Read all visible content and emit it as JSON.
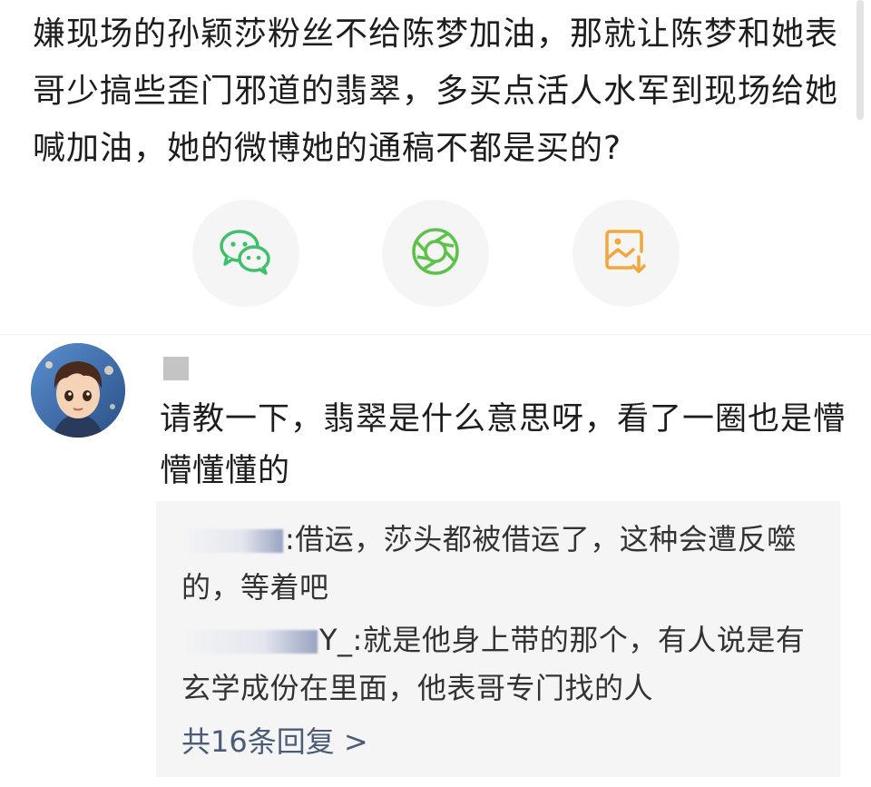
{
  "post": {
    "text": "嫌现场的孙颖莎粉丝不给陈梦加油，那就让陈梦和她表哥少搞些歪门邪道的翡翠，多买点活人水军到现场给她喊加油，她的微博她的通稿不都是买的?"
  },
  "share": {
    "wechat_icon": "wechat-icon",
    "moments_icon": "moments-icon",
    "save_icon": "save-image-icon",
    "colors": {
      "wechat": "#3fc06a",
      "moments": "#5cc24a",
      "save": "#f0a83a",
      "button_bg": "#f5f5f5"
    }
  },
  "comment": {
    "avatar_icon": "avatar-boy",
    "text": "请教一下，翡翠是什么意思呀，看了一圈也是懵懵懂懂的",
    "replies": [
      {
        "user_suffix": "【",
        "user_tail": "\u0011",
        "user_visible": ":",
        "text": "借运，莎头都被借运了，这种会遭反噬的，等着吧"
      },
      {
        "user_visible": "Y_:",
        "text": "就是他身上带的那个，有人说是有玄学成份在里面，他表哥专门找的人"
      }
    ],
    "reply_count_label": "共16条回复 >"
  }
}
